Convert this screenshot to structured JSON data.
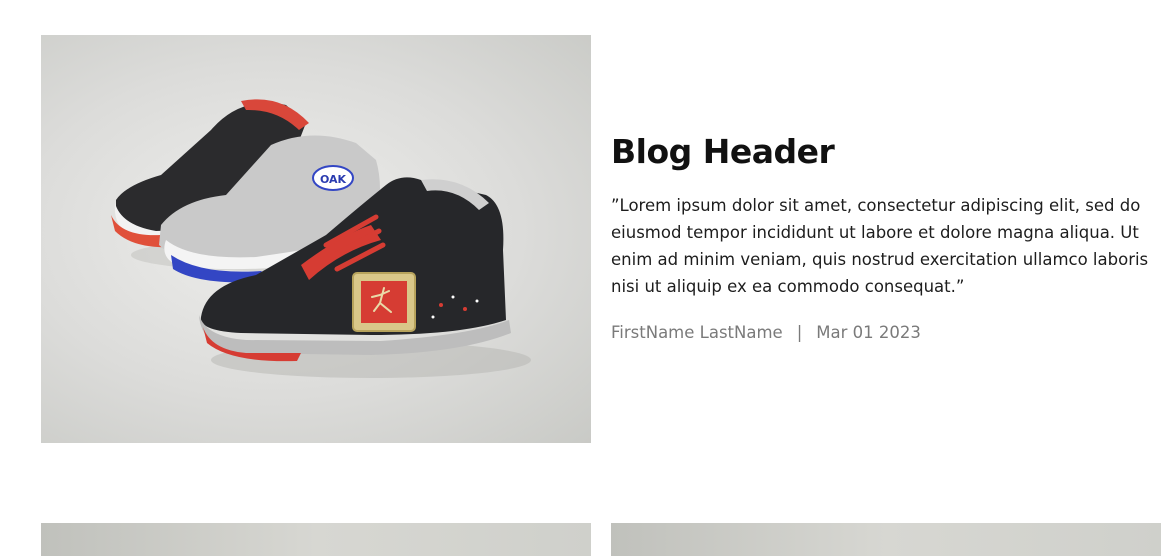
{
  "post": {
    "title": "Blog Header",
    "excerpt": "”Lorem ipsum dolor sit amet, consectetur adipiscing elit, sed do eiusmod tempor incididunt ut labore et dolore magna aliqua. Ut enim ad minim veniam, quis nostrud exercitation ullamco laboris nisi ut aliquip ex ea commodo consequat.”",
    "author": "FirstName LastName",
    "separator": "|",
    "date": "Mar 01 2023",
    "image_label": "OAK"
  },
  "colors": {
    "accent_red": "#d63c33",
    "shoe_black": "#26272a",
    "shoe_gray": "#b8b8b8",
    "background": "#ffffff"
  }
}
